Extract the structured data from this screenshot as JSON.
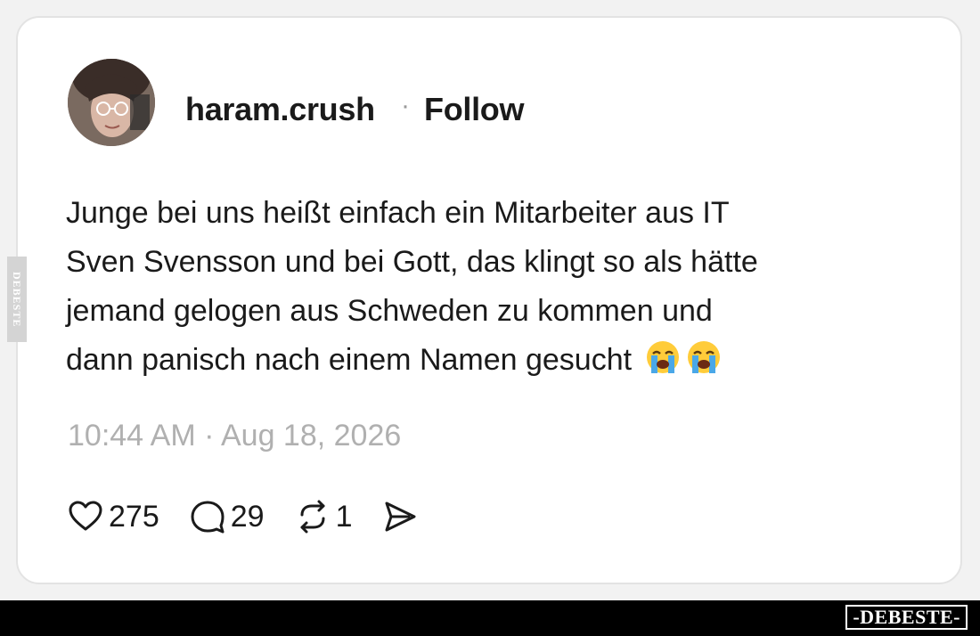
{
  "post": {
    "username": "haram.crush",
    "separator": "·",
    "follow_label": "Follow",
    "text_lines": [
      "Junge bei uns heißt einfach ein Mitarbeiter aus IT",
      "Sven Svensson und bei Gott, das klingt so als hätte",
      "jemand gelogen aus Schweden zu kommen und",
      "dann panisch nach einem Namen gesucht"
    ],
    "emojis": [
      "loudly-crying-face",
      "loudly-crying-face"
    ],
    "timestamp": "10:44 AM · Aug 18, 2026",
    "likes": "275",
    "replies": "29",
    "reposts": "1"
  },
  "icons": {
    "like": "heart-icon",
    "reply": "speech-bubble-icon",
    "repost": "repost-arrows-icon",
    "share": "send-icon"
  },
  "watermark": {
    "side_text": "DEBESTE",
    "footer_text": "-DEBESTE-"
  },
  "colors": {
    "text": "#1a1a1a",
    "muted": "#b0b0b0",
    "card_border": "#e3e3e3",
    "footer": "#000000"
  }
}
